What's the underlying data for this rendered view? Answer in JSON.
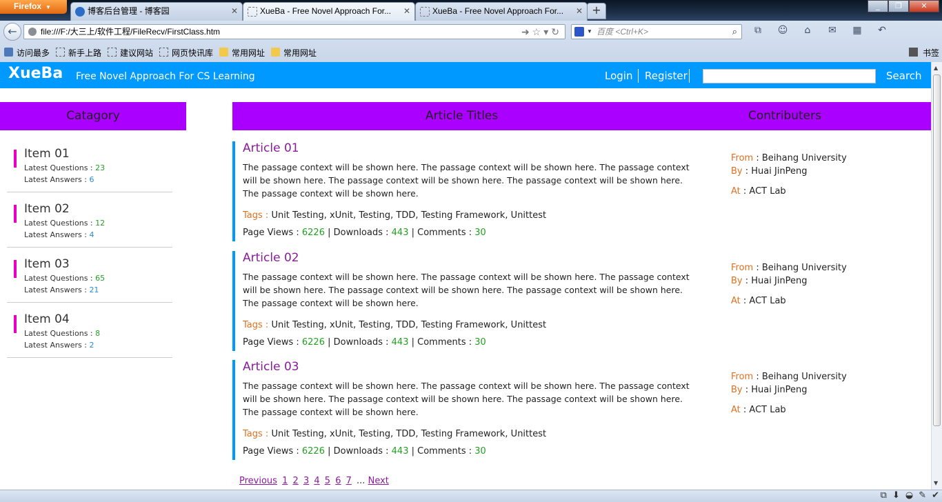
{
  "browser": {
    "app_button": "Firefox",
    "tabs": [
      {
        "label": "博客后台管理 - 博客园"
      },
      {
        "label": "XueBa - Free Novel Approach For..."
      },
      {
        "label": "XueBa - Free Novel Approach For..."
      }
    ],
    "new_tab": "+",
    "url": "file:///F:/大三上/软件工程/FileRecv/FirstClass.htm",
    "search_placeholder": "百度 <Ctrl+K>",
    "bookmarks": [
      "访问最多",
      "新手上路",
      "建议网站",
      "网页快讯库",
      "常用网址",
      "常用网址"
    ],
    "bookmarks_right": "书签"
  },
  "site": {
    "brand": "XueBa",
    "slogan": "Free Novel Approach For CS Learning",
    "login": "Login",
    "register": "Register",
    "search_button": "Search"
  },
  "headers": {
    "category": "Catagory",
    "titles": "Article Titles",
    "contributors": "Contributers"
  },
  "categories": [
    {
      "title": "Item 01",
      "q_label": "Latest Questions : ",
      "q": "23",
      "a_label": "Latest Answers : ",
      "a": "6"
    },
    {
      "title": "Item 02",
      "q_label": "Latest Questions : ",
      "q": "12",
      "a_label": "Latest Answers : ",
      "a": "4"
    },
    {
      "title": "Item 03",
      "q_label": "Latest Questions : ",
      "q": "65",
      "a_label": "Latest Answers : ",
      "a": "21"
    },
    {
      "title": "Item 04",
      "q_label": "Latest Questions : ",
      "q": "8",
      "a_label": "Latest Answers : ",
      "a": "2"
    }
  ],
  "articles": [
    {
      "title": "Article 01",
      "body": "The passage context will be shown here. The passage context will be shown here. The passage context will be shown here. The passage context will be shown here. The passage context will be shown here. The passage context will be shown here.",
      "tags_label": "Tags : ",
      "tags": "Unit Testing, xUnit, Testing, TDD, Testing Framework, Unittest",
      "views_label": "Page Views : ",
      "views": "6226",
      "downloads_label": " | Downloads : ",
      "downloads": "443",
      "comments_label": " | Comments : ",
      "comments": "30",
      "from_label": "From",
      "from": " : Beihang University",
      "by_label": "By",
      "by": " : Huai JinPeng",
      "at_label": "At",
      "at": " : ACT Lab"
    },
    {
      "title": "Article 02",
      "body": "The passage context will be shown here. The passage context will be shown here. The passage context will be shown here. The passage context will be shown here. The passage context will be shown here. The passage context will be shown here.",
      "tags_label": "Tags : ",
      "tags": "Unit Testing, xUnit, Testing, TDD, Testing Framework, Unittest",
      "views_label": "Page Views : ",
      "views": "6226",
      "downloads_label": " | Downloads : ",
      "downloads": "443",
      "comments_label": " | Comments : ",
      "comments": "30",
      "from_label": "From",
      "from": " : Beihang University",
      "by_label": "By",
      "by": " : Huai JinPeng",
      "at_label": "At",
      "at": " : ACT Lab"
    },
    {
      "title": "Article 03",
      "body": "The passage context will be shown here. The passage context will be shown here. The passage context will be shown here. The passage context will be shown here. The passage context will be shown here. The passage context will be shown here.",
      "tags_label": "Tags : ",
      "tags": "Unit Testing, xUnit, Testing, TDD, Testing Framework, Unittest",
      "views_label": "Page Views : ",
      "views": "6226",
      "downloads_label": " | Downloads : ",
      "downloads": "443",
      "comments_label": " | Comments : ",
      "comments": "30",
      "from_label": "From",
      "from": " : Beihang University",
      "by_label": "By",
      "by": " : Huai JinPeng",
      "at_label": "At",
      "at": " : ACT Lab"
    }
  ],
  "pager": {
    "previous": "Previous",
    "pages": [
      "1",
      "2",
      "3",
      "4",
      "5",
      "6",
      "7"
    ],
    "ellipsis": "...",
    "next": "Next"
  },
  "colors": {
    "header_blue": "#0099ff",
    "section_purple": "#aa00ff",
    "category_accent": "#e800c8",
    "title_purple": "#8b1a9e",
    "label_orange": "#e07020",
    "count_green": "#22a022"
  }
}
